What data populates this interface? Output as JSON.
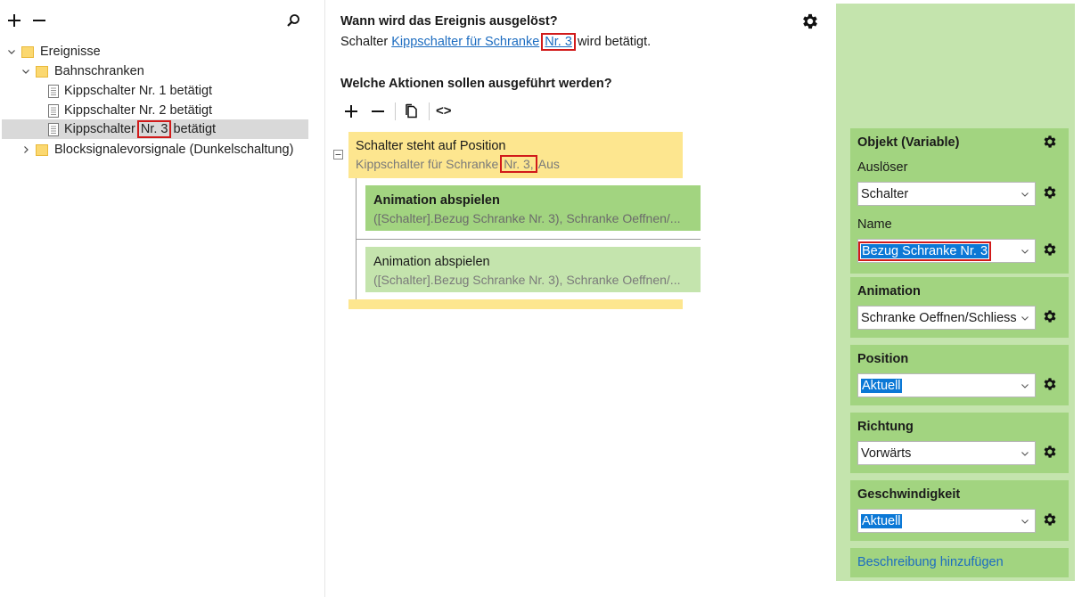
{
  "tree": {
    "items": [
      {
        "label": "Ereignisse"
      },
      {
        "label": "Bahnschranken"
      },
      {
        "label": "Kippschalter Nr. 1 betätigt"
      },
      {
        "label": "Kippschalter Nr. 2 betätigt"
      },
      {
        "label_pre": "Kippschalter ",
        "label_hl": "Nr. 3",
        "label_post": " betätigt"
      },
      {
        "label": "Blocksignalevorsignale (Dunkelschaltung)"
      }
    ]
  },
  "trigger": {
    "heading": "Wann wird das Ereignis ausgelöst?",
    "prefix": "Schalter ",
    "link_text": "Kippschalter für Schranke",
    "link_hl": "Nr. 3",
    "suffix": " wird betätigt."
  },
  "actions": {
    "heading": "Welche Aktionen sollen ausgeführt werden?",
    "toolbar": {
      "code_label": "<>"
    },
    "condition": {
      "title": "Schalter steht auf Position",
      "sub_pre": "Kippschalter für Schranke ",
      "sub_hl": "Nr. 3,",
      "sub_post": " Aus"
    },
    "items": [
      {
        "title": "Animation abspielen",
        "sub": "([Schalter].Bezug Schranke Nr. 3), Schranke Oeffnen/..."
      },
      {
        "title": "Animation abspielen",
        "sub": "([Schalter].Bezug Schranke Nr. 3), Schranke Oeffnen/..."
      }
    ]
  },
  "properties": {
    "object_card": {
      "title": "Objekt (Variable)",
      "trigger_label": "Auslöser",
      "trigger_value": "Schalter",
      "name_label": "Name",
      "name_value": "Bezug Schranke Nr. 3"
    },
    "animation_card": {
      "title": "Animation",
      "value": "Schranke Oeffnen/Schliess"
    },
    "position_card": {
      "title": "Position",
      "value": "Aktuell"
    },
    "direction_card": {
      "title": "Richtung",
      "value": "Vorwärts"
    },
    "speed_card": {
      "title": "Geschwindigkeit",
      "value": "Aktuell"
    },
    "description_link": "Beschreibung hinzufügen"
  },
  "colors": {
    "highlight_border": "#d11a1a",
    "link": "#1c6cc0",
    "condition_bg": "#fde68f",
    "action_selected_bg": "#a2d480",
    "action_bg": "#c4e4ad",
    "selection_blue": "#0b78d6"
  }
}
